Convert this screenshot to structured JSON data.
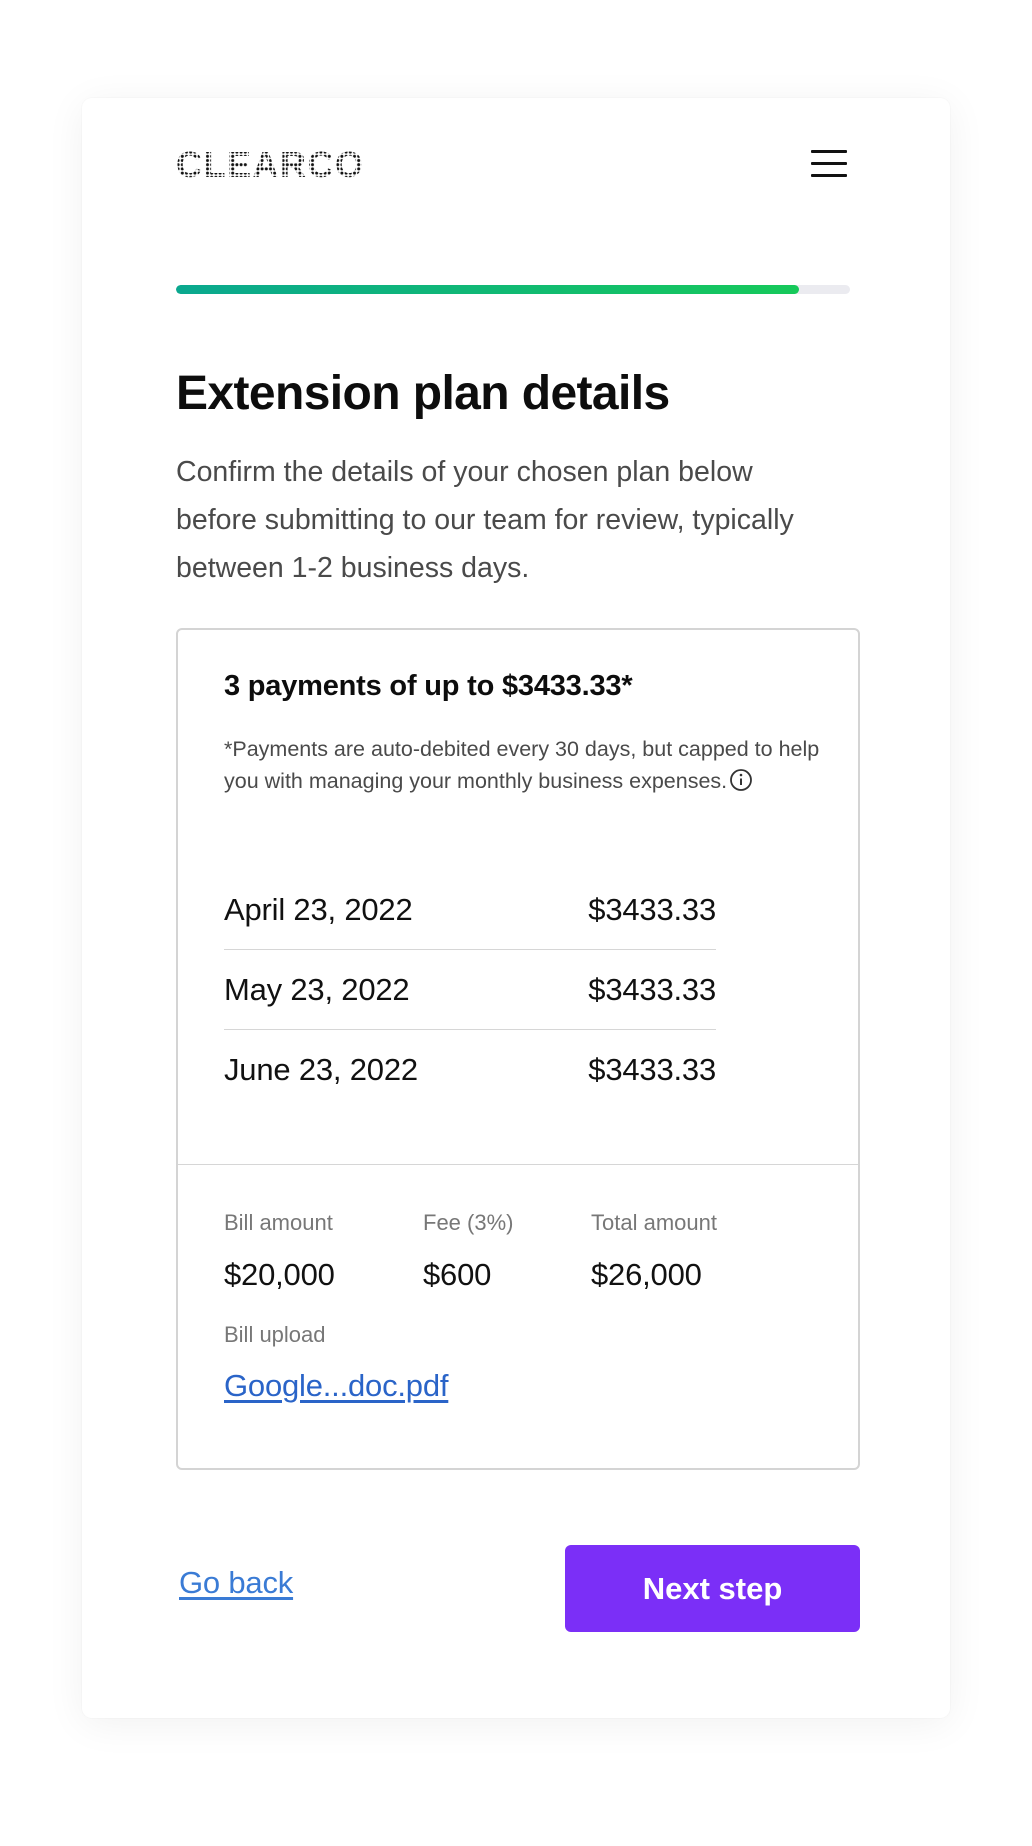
{
  "header": {
    "logo_text": "CLEARCO",
    "menu_icon": "hamburger-menu-icon"
  },
  "progress": {
    "percent": 92.5,
    "colors": [
      "#0aa88f",
      "#16c95a"
    ]
  },
  "page": {
    "title": "Extension plan details",
    "subtitle": "Confirm the details of your chosen plan below before submitting to our team for review, typically between 1-2 business days."
  },
  "plan": {
    "heading": "3 payments of up to $3433.33*",
    "note": "*Payments are auto-debited every 30 days, but capped to help you with managing your monthly business expenses.",
    "info_icon": "info-icon",
    "schedule": [
      {
        "date": "April 23, 2022",
        "amount": "$3433.33"
      },
      {
        "date": "May 23, 2022",
        "amount": "$3433.33"
      },
      {
        "date": "June 23, 2022",
        "amount": "$3433.33"
      }
    ],
    "summary": {
      "bill_amount_label": "Bill amount",
      "bill_amount_value": "$20,000",
      "fee_label": "Fee (3%)",
      "fee_value": "$600",
      "total_label": "Total amount",
      "total_value": "$26,000"
    },
    "upload": {
      "label": "Bill upload",
      "file_name": "Google...doc.pdf"
    }
  },
  "actions": {
    "back_label": "Go back",
    "next_label": "Next step"
  },
  "colors": {
    "accent": "#7b2ff7",
    "link": "#2a64c8"
  }
}
